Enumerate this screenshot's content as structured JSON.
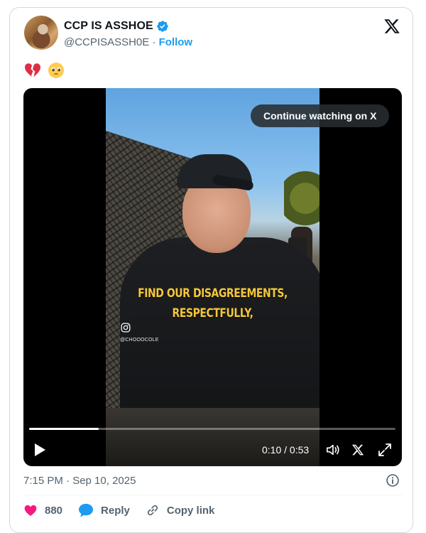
{
  "author": {
    "display_name": "CCP IS ASSHOE",
    "handle": "@CCPISASSH0E",
    "separator": "·",
    "follow_label": "Follow"
  },
  "post": {
    "emoji": [
      "broken-heart",
      "pleading-face"
    ]
  },
  "video": {
    "continue_label": "Continue watching on X",
    "caption_line1": "FIND OUR DISAGREEMENTS,",
    "caption_line2": "RESPECTFULLY,",
    "watermark_handle": "@CHOOOCOLE",
    "time": "0:10 / 0:53",
    "progress": 0.19
  },
  "meta": {
    "timestamp": "7:15 PM · Sep 10, 2025"
  },
  "actions": {
    "likes": "880",
    "reply_label": "Reply",
    "copy_link_label": "Copy link"
  },
  "colors": {
    "accent": "#1d9bf0",
    "like": "#f91880",
    "reply": "#1d9bf0",
    "caption": "#f3c73a"
  }
}
